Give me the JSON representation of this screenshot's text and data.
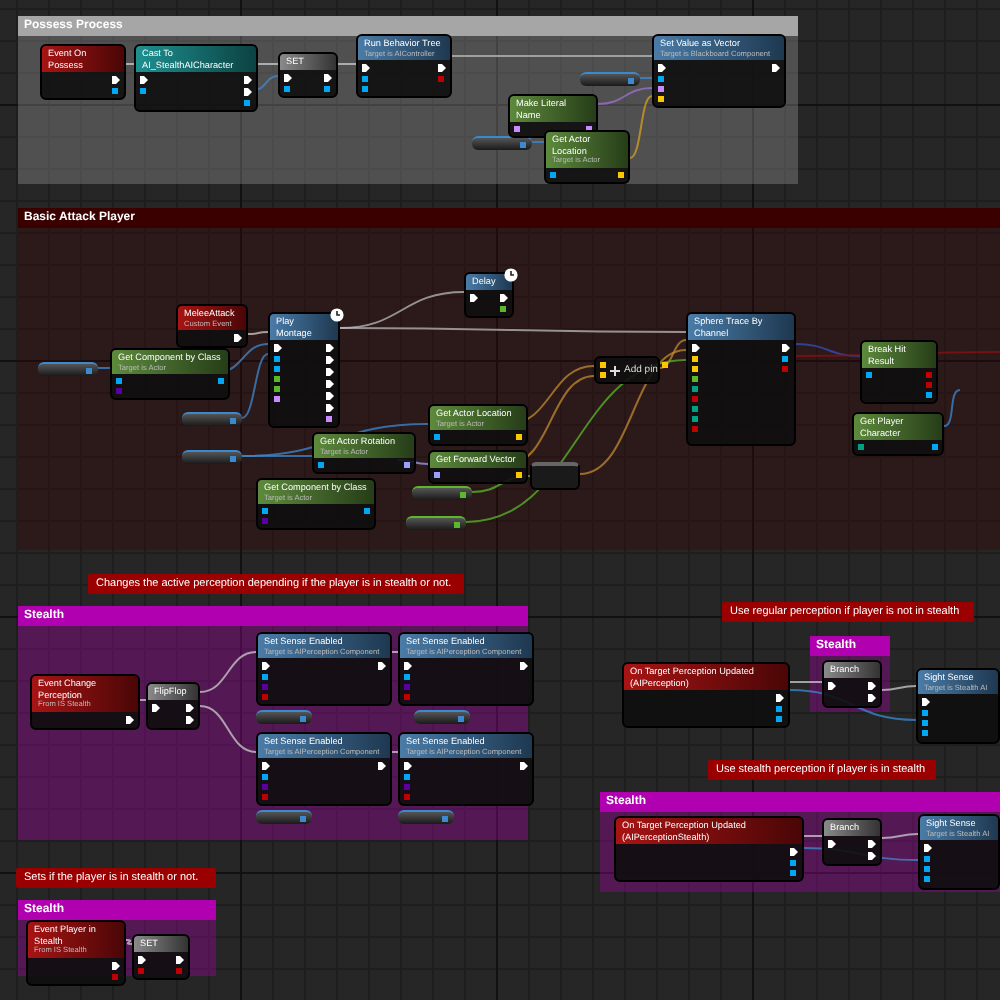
{
  "comments": [
    {
      "title": "Possess Process",
      "color": "#a6a6a6"
    },
    {
      "title": "Basic Attack Player",
      "color": "#3a0000"
    },
    {
      "title": "Stealth",
      "color": "#b000b0"
    },
    {
      "title": "Stealth",
      "color": "#b000b0"
    },
    {
      "title": "Stealth",
      "color": "#b000b0"
    },
    {
      "title": "Stealth",
      "color": "#b000b0"
    }
  ],
  "notes": [
    "Changes the active perception depending if the player is in stealth or not.",
    "Use regular perception if player is not in stealth",
    "Use stealth perception if player is in stealth",
    "Sets if the player is in stealth or not."
  ],
  "nodes": [
    {
      "kind": "event",
      "title": "Event On Possess"
    },
    {
      "kind": "cast",
      "title": "Cast To AI_StealthAICharacter"
    },
    {
      "kind": "macro",
      "title": "SET"
    },
    {
      "kind": "function",
      "title": "Run Behavior Tree",
      "subtitle": "Target is AIController"
    },
    {
      "kind": "pure",
      "title": "Make Literal Name"
    },
    {
      "kind": "pure",
      "title": "Get Actor Location",
      "subtitle": "Target is Actor"
    },
    {
      "kind": "function",
      "title": "Set Value as Vector",
      "subtitle": "Target is Blackboard Component"
    },
    {
      "kind": "function",
      "title": "Delay"
    },
    {
      "kind": "event",
      "title": "MeleeAttack",
      "subtitle": "Custom Event"
    },
    {
      "kind": "function",
      "title": "Play Montage"
    },
    {
      "kind": "pure",
      "title": "Get Component by Class",
      "subtitle": "Target is Actor"
    },
    {
      "kind": "pure",
      "title": "Get Actor Location",
      "subtitle": "Target is Actor"
    },
    {
      "kind": "pure",
      "title": "Get Actor Rotation",
      "subtitle": "Target is Actor"
    },
    {
      "kind": "pure",
      "title": "Get Forward Vector"
    },
    {
      "kind": "pure",
      "title": "Get Component by Class",
      "subtitle": "Target is Actor"
    },
    {
      "kind": "operator",
      "title": "Add pin"
    },
    {
      "kind": "function",
      "title": "Sphere Trace By Channel"
    },
    {
      "kind": "pure",
      "title": "Break Hit Result"
    },
    {
      "kind": "pure",
      "title": "Get Player Character"
    },
    {
      "kind": "event",
      "title": "Event Change Perception",
      "subtitle": "From IS Stealth"
    },
    {
      "kind": "macro",
      "title": "FlipFlop"
    },
    {
      "kind": "function",
      "title": "Set Sense Enabled",
      "subtitle": "Target is AIPerception Component"
    },
    {
      "kind": "function",
      "title": "Set Sense Enabled",
      "subtitle": "Target is AIPerception Component"
    },
    {
      "kind": "function",
      "title": "Set Sense Enabled",
      "subtitle": "Target is AIPerception Component"
    },
    {
      "kind": "function",
      "title": "Set Sense Enabled",
      "subtitle": "Target is AIPerception Component"
    },
    {
      "kind": "event",
      "title": "On Target Perception Updated (AIPerception)"
    },
    {
      "kind": "macro",
      "title": "Branch"
    },
    {
      "kind": "function",
      "title": "Sight Sense",
      "subtitle": "Target is Stealth AI"
    },
    {
      "kind": "event",
      "title": "On Target Perception Updated (AIPerceptionStealth)"
    },
    {
      "kind": "macro",
      "title": "Branch"
    },
    {
      "kind": "function",
      "title": "Sight Sense",
      "subtitle": "Target is Stealth AI"
    },
    {
      "kind": "event",
      "title": "Event Player in Stealth",
      "subtitle": "From IS Stealth"
    },
    {
      "kind": "macro",
      "title": "SET"
    }
  ]
}
